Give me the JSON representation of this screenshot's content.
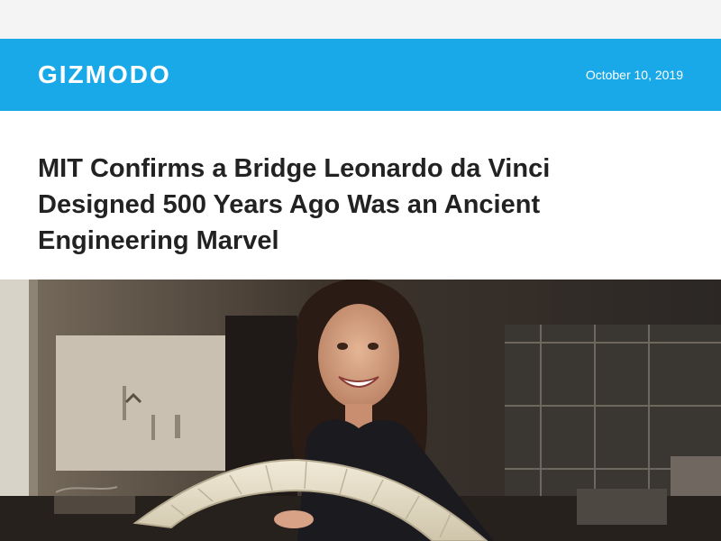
{
  "header": {
    "logo": "GIZMODO",
    "date": "October 10, 2019",
    "brand_color": "#1aa9e8"
  },
  "article": {
    "headline": "MIT Confirms a Bridge Leonardo da Vinci Designed 500 Years Ago Was an Ancient Engineering Marvel"
  },
  "hero": {
    "icon": "photo-woman-with-bridge-model"
  }
}
